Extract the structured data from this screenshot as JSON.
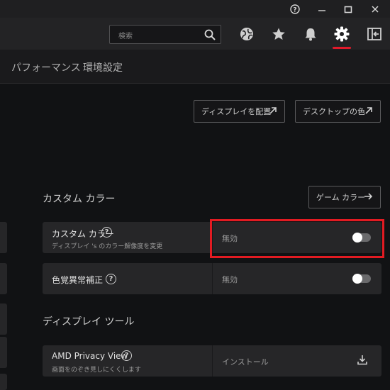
{
  "titlebar": {
    "help": "?",
    "minimize": "—",
    "maximize": "☐",
    "close": "✕"
  },
  "topbar": {
    "search_placeholder": "検索",
    "icons": [
      "globe-icon",
      "star-icon",
      "bell-icon",
      "gear-icon",
      "sidebar-exit-icon"
    ],
    "accent_color": "#e11a2b"
  },
  "subnav": {
    "tabs": [
      "パフォーマンス",
      "環境設定"
    ]
  },
  "actions": {
    "arrange_display": "ディスプレイを配置",
    "desktop_color": "デスクトップの色"
  },
  "custom_color_section": {
    "title": "カスタム カラー",
    "game_color_button": "ゲーム カラー"
  },
  "rows": {
    "custom_color": {
      "label": "カスタム カラー",
      "sublabel": "ディスプレイ 's のカラー解像度を変更",
      "value": "無効",
      "toggle_on": false
    },
    "color_blind": {
      "label": "色覚異常補正",
      "value": "無効",
      "toggle_on": false
    }
  },
  "display_tools_section": {
    "title": "ディスプレイ ツール"
  },
  "privacy_view": {
    "label": "AMD Privacy View",
    "sublabel": "画面をのぞき見しにくくします",
    "value": "インストール"
  }
}
